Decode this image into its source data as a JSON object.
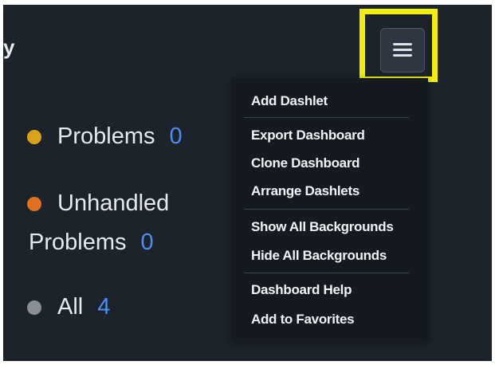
{
  "page": {
    "title_fragment": "y"
  },
  "menu_button": {
    "icon": "hamburger-icon",
    "highlight_color": "#f2ee0a"
  },
  "stats": [
    {
      "label": "Problems",
      "count": "0",
      "dot_color": "#d9a21b"
    },
    {
      "label_line1": "Unhandled",
      "label_line2": "Problems",
      "count": "0",
      "dot_color": "#e07020"
    },
    {
      "label": "All",
      "count": "4",
      "dot_color": "#8a8f96"
    }
  ],
  "dropdown": {
    "groups": [
      [
        "Add Dashlet"
      ],
      [
        "Export Dashboard",
        "Clone Dashboard",
        "Arrange Dashlets"
      ],
      [
        "Show All Backgrounds",
        "Hide All Backgrounds"
      ],
      [
        "Dashboard Help",
        "Add to Favorites"
      ]
    ]
  },
  "colors": {
    "background": "#1c232b",
    "menu_background": "#141a20",
    "count_link": "#4d8ef0",
    "text": "#e6e9ee"
  }
}
